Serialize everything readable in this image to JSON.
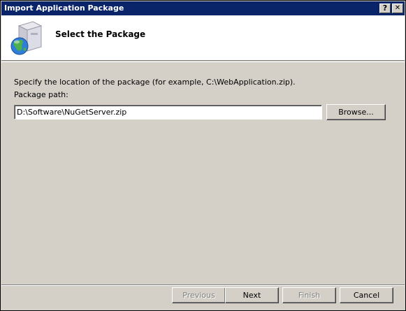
{
  "window": {
    "title": "Import Application Package",
    "help_glyph": "?",
    "close_glyph": "✕"
  },
  "header": {
    "title": "Select the Package",
    "icon": "package-globe-icon"
  },
  "main": {
    "instruction": "Specify the location of the package (for example, C:\\WebApplication.zip).",
    "path_label": "Package path:",
    "path_value": "D:\\Software\\NuGetServer.zip",
    "browse_label": "Browse..."
  },
  "footer": {
    "previous_label": "Previous",
    "next_label": "Next",
    "finish_label": "Finish",
    "cancel_label": "Cancel"
  },
  "colors": {
    "titlebar": "#0a246a",
    "dialog_bg": "#d4d0c8",
    "header_bg": "#ffffff"
  }
}
